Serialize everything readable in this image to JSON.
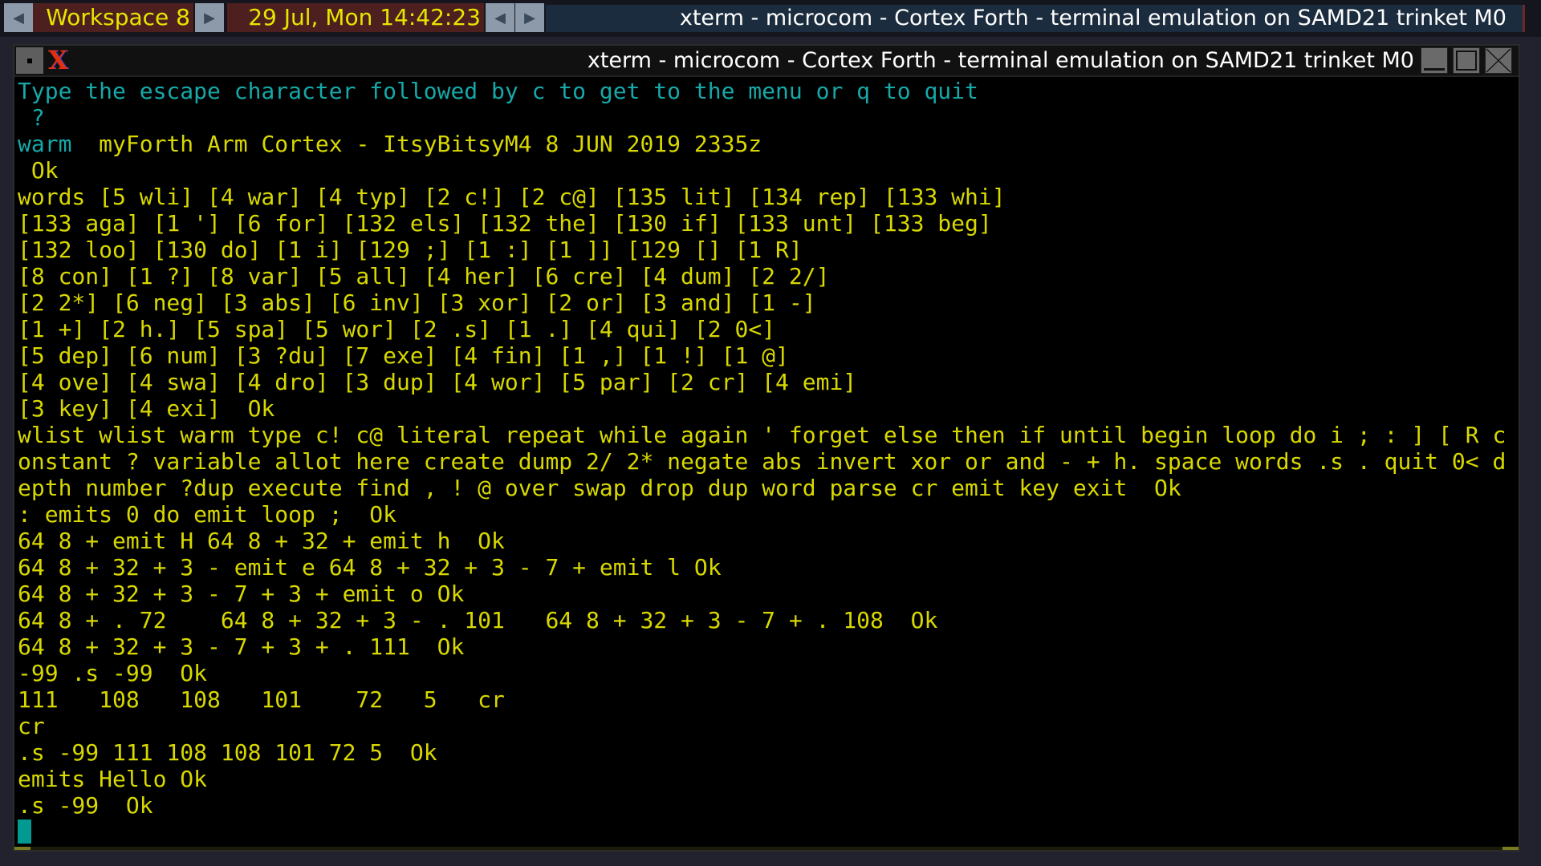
{
  "taskbar": {
    "workspace": "Workspace 8",
    "datetime": "29 Jul, Mon 14:42:23",
    "window_title": "xterm - microcom - Cortex Forth - terminal emulation on SAMD21 trinket M0"
  },
  "window": {
    "title": "xterm - microcom - Cortex Forth - terminal emulation on SAMD21 trinket M0",
    "buttons": [
      "minimize",
      "maximize",
      "close"
    ]
  },
  "colors": {
    "cyan": "#17a8a8",
    "yellow": "#d8d800",
    "cursor": "#009a90"
  },
  "terminal": {
    "lines": [
      [
        {
          "t": "Type the escape character followed by c to get to the menu or q to quit",
          "c": "cyan"
        }
      ],
      [
        {
          "t": " ?",
          "c": "cyan"
        }
      ],
      [
        {
          "t": "warm",
          "c": "cyan"
        },
        {
          "t": "  myForth Arm Cortex - ItsyBitsyM4 8 JUN 2019 2335z",
          "c": "yellow"
        }
      ],
      [
        {
          "t": " Ok",
          "c": "yellow"
        }
      ],
      [
        {
          "t": "words [5 wli] [4 war] [4 typ] [2 c!] [2 c@] [135 lit] [134 rep] [133 whi]",
          "c": "yellow"
        }
      ],
      [
        {
          "t": "[133 aga] [1 '] [6 for] [132 els] [132 the] [130 if] [133 unt] [133 beg]",
          "c": "yellow"
        }
      ],
      [
        {
          "t": "[132 loo] [130 do] [1 i] [129 ;] [1 :] [1 ]] [129 [] [1 R]",
          "c": "yellow"
        }
      ],
      [
        {
          "t": "[8 con] [1 ?] [8 var] [5 all] [4 her] [6 cre] [4 dum] [2 2/]",
          "c": "yellow"
        }
      ],
      [
        {
          "t": "[2 2*] [6 neg] [3 abs] [6 inv] [3 xor] [2 or] [3 and] [1 -]",
          "c": "yellow"
        }
      ],
      [
        {
          "t": "[1 +] [2 h.] [5 spa] [5 wor] [2 .s] [1 .] [4 qui] [2 0<]",
          "c": "yellow"
        }
      ],
      [
        {
          "t": "[5 dep] [6 num] [3 ?du] [7 exe] [4 fin] [1 ,] [1 !] [1 @]",
          "c": "yellow"
        }
      ],
      [
        {
          "t": "[4 ove] [4 swa] [4 dro] [3 dup] [4 wor] [5 par] [2 cr] [4 emi]",
          "c": "yellow"
        }
      ],
      [
        {
          "t": "[3 key] [4 exi]  Ok",
          "c": "yellow"
        }
      ],
      [
        {
          "t": "wlist wlist warm type c! c@ literal repeat while again ' forget else then if until begin loop do i ; : ] [ R c",
          "c": "yellow"
        }
      ],
      [
        {
          "t": "onstant ? variable allot here create dump 2/ 2* negate abs invert xor or and - + h. space words .s . quit 0< d",
          "c": "yellow"
        }
      ],
      [
        {
          "t": "epth number ?dup execute find , ! @ over swap drop dup word parse cr emit key exit  Ok",
          "c": "yellow"
        }
      ],
      [
        {
          "t": ": emits 0 do emit loop ;  Ok",
          "c": "yellow"
        }
      ],
      [
        {
          "t": "64 8 + emit H 64 8 + 32 + emit h  Ok",
          "c": "yellow"
        }
      ],
      [
        {
          "t": "64 8 + 32 + 3 - emit e 64 8 + 32 + 3 - 7 + emit l Ok",
          "c": "yellow"
        }
      ],
      [
        {
          "t": "64 8 + 32 + 3 - 7 + 3 + emit o Ok",
          "c": "yellow"
        }
      ],
      [
        {
          "t": "64 8 + . 72    64 8 + 32 + 3 - . 101   64 8 + 32 + 3 - 7 + . 108  Ok",
          "c": "yellow"
        }
      ],
      [
        {
          "t": "64 8 + 32 + 3 - 7 + 3 + . 111  Ok",
          "c": "yellow"
        }
      ],
      [
        {
          "t": "-99 .s -99  Ok",
          "c": "yellow"
        }
      ],
      [
        {
          "t": "111   108   108   101    72   5   cr",
          "c": "yellow"
        }
      ],
      [
        {
          "t": "cr",
          "c": "yellow"
        }
      ],
      [
        {
          "t": ".s -99 111 108 108 101 72 5  Ok",
          "c": "yellow"
        }
      ],
      [
        {
          "t": "emits Hello Ok",
          "c": "yellow"
        }
      ],
      [
        {
          "t": ".s -99  Ok",
          "c": "yellow"
        }
      ]
    ]
  }
}
